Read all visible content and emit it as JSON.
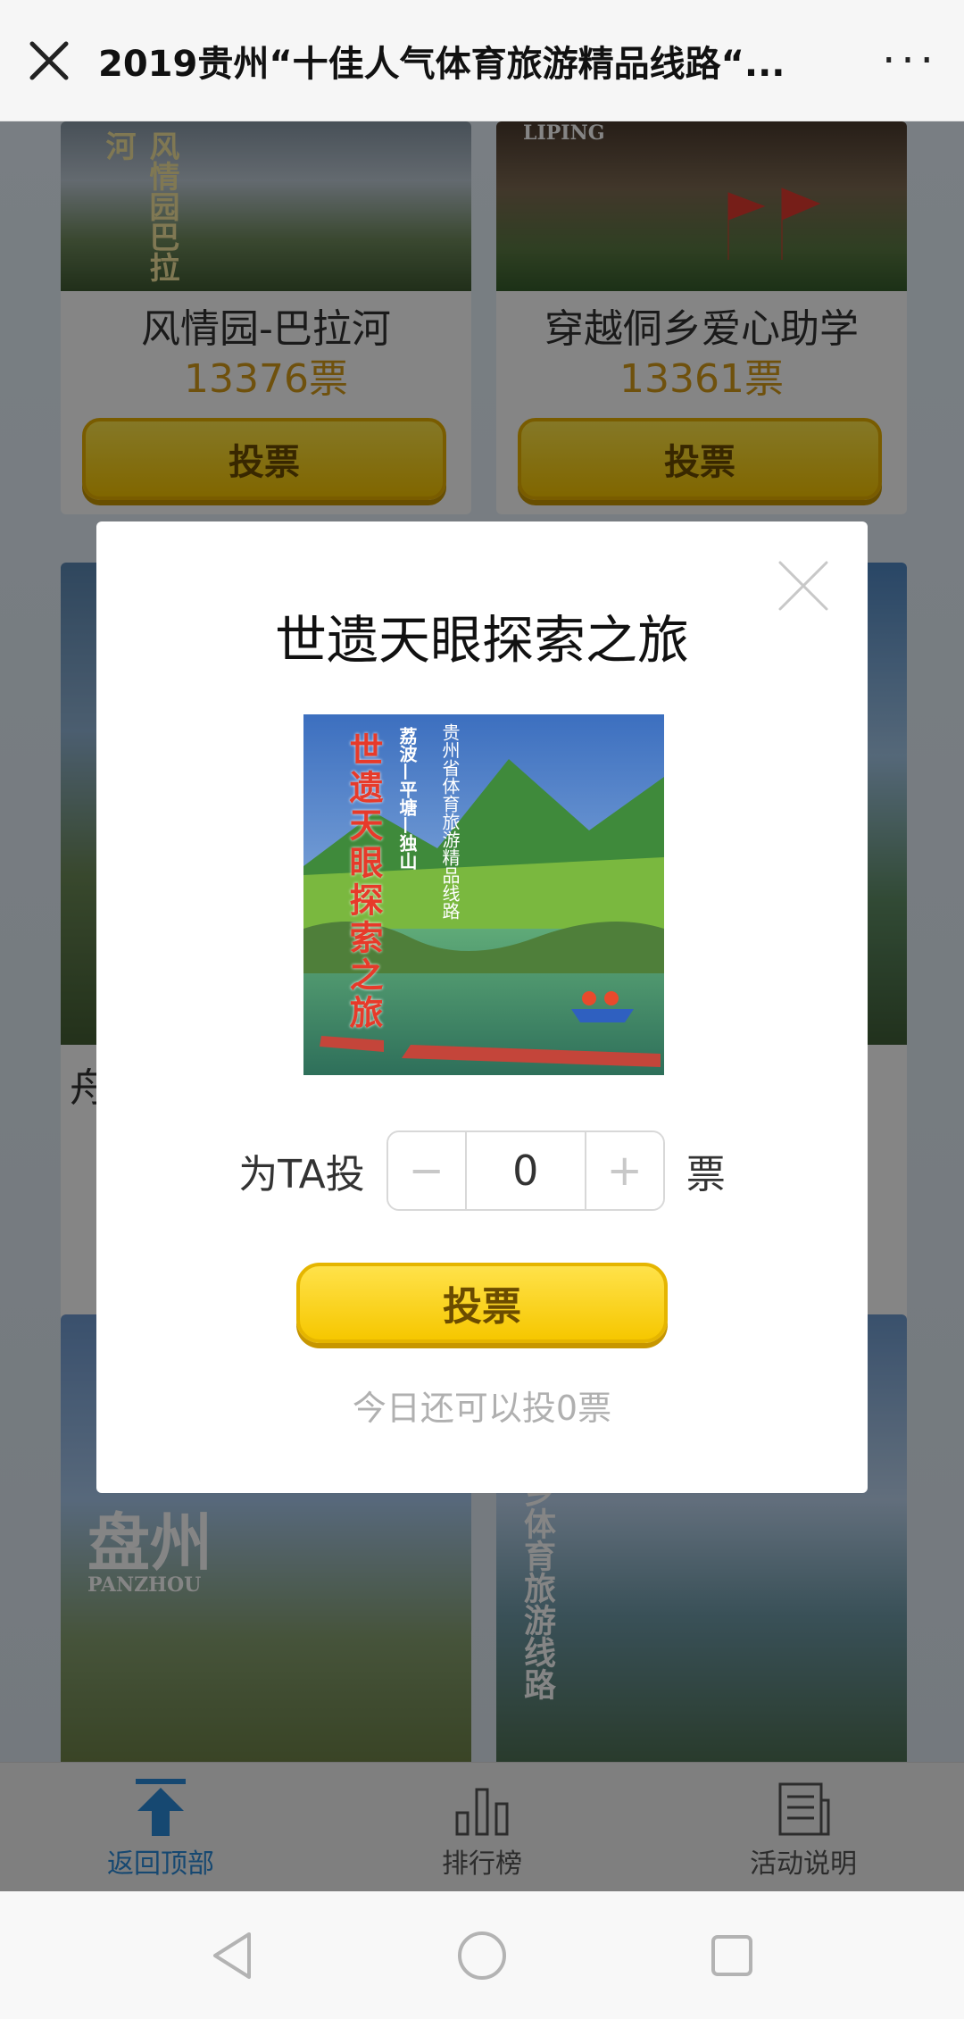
{
  "topbar": {
    "close_icon": "close-icon",
    "title": "2019贵州“十佳人气体育旅游精品线路“...",
    "more": "···"
  },
  "cards": [
    {
      "name": "风情园-巴拉河",
      "votes": "13376票",
      "vote_label": "投票",
      "img_text": "风情园巴拉河"
    },
    {
      "name": "穿越侗乡爱心助学",
      "votes": "13361票",
      "vote_label": "投票",
      "img_text": "LIPING"
    },
    {
      "name": "舟",
      "votes": "",
      "vote_label": "",
      "img_text": ""
    },
    {
      "name": "",
      "votes": "",
      "vote_label": "",
      "img_text": ""
    },
    {
      "name": "",
      "votes": "",
      "vote_label": "",
      "img_text": "盘州",
      "img_subtext": "PANZHOU"
    },
    {
      "name": "",
      "votes": "",
      "vote_label": "",
      "img_text": "乡体育旅游线路"
    }
  ],
  "modal": {
    "title": "世遗天眼探索之旅",
    "image_text": "世遗天眼探索之旅",
    "image_subtext": "贵州省体育旅游精品线路",
    "image_tag": "荔波—平塘—独山",
    "for_label": "为TA投",
    "quantity": "0",
    "minus": "−",
    "plus": "+",
    "unit": "票",
    "submit_label": "投票",
    "remaining": "今日还可以投0票"
  },
  "bottom_nav": {
    "back_top": "返回顶部",
    "ranking": "排行榜",
    "rules": "活动说明"
  },
  "colors": {
    "accent": "#2b8bd8",
    "button_yellow": "#f6c400",
    "vote_count": "#d59b1a"
  }
}
